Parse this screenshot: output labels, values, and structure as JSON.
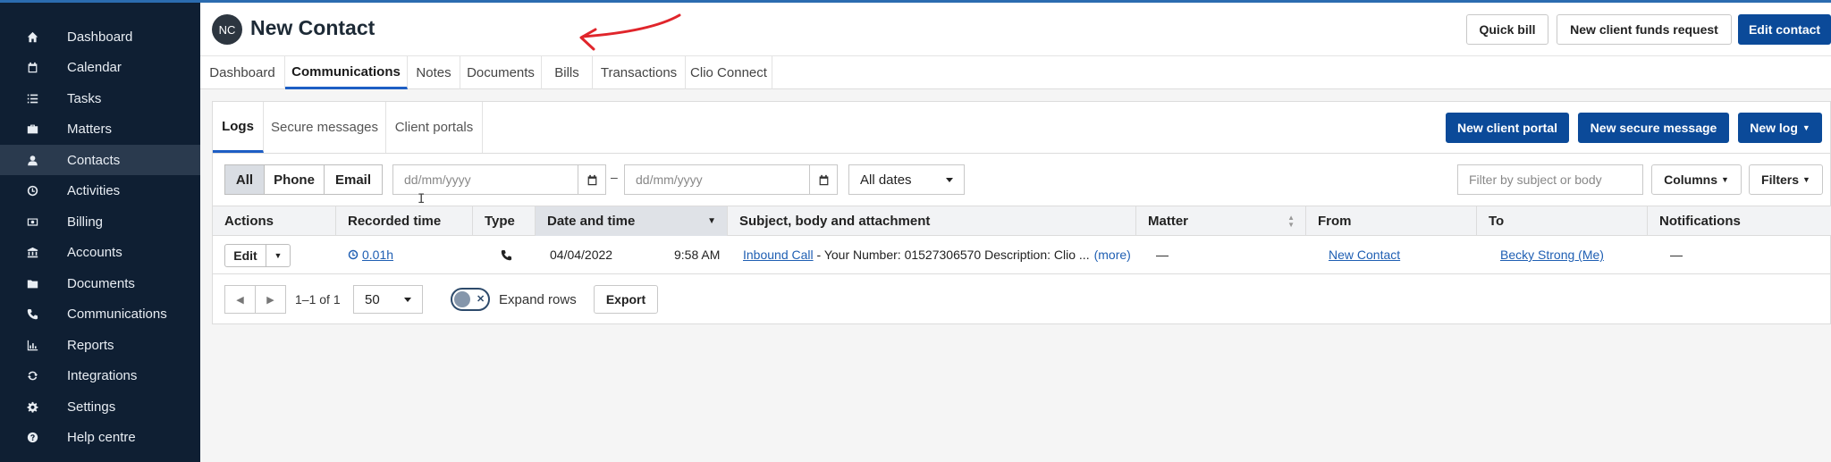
{
  "sidebar": {
    "items": [
      {
        "label": "Dashboard",
        "icon": "home-icon"
      },
      {
        "label": "Calendar",
        "icon": "calendar-icon"
      },
      {
        "label": "Tasks",
        "icon": "list-icon"
      },
      {
        "label": "Matters",
        "icon": "briefcase-icon"
      },
      {
        "label": "Contacts",
        "icon": "user-icon",
        "active": true
      },
      {
        "label": "Activities",
        "icon": "clock-icon"
      },
      {
        "label": "Billing",
        "icon": "money-icon"
      },
      {
        "label": "Accounts",
        "icon": "bank-icon"
      },
      {
        "label": "Documents",
        "icon": "folder-icon"
      },
      {
        "label": "Communications",
        "icon": "phone-icon"
      },
      {
        "label": "Reports",
        "icon": "bar-chart-icon"
      },
      {
        "label": "Integrations",
        "icon": "refresh-icon"
      },
      {
        "label": "Settings",
        "icon": "gear-icon"
      },
      {
        "label": "Help centre",
        "icon": "question-icon"
      }
    ]
  },
  "header": {
    "avatar_initials": "NC",
    "title": "New Contact",
    "buttons": {
      "quick_bill": "Quick bill",
      "funds_request": "New client funds request",
      "edit_contact": "Edit contact"
    }
  },
  "tabs": [
    "Dashboard",
    "Communications",
    "Notes",
    "Documents",
    "Bills",
    "Transactions",
    "Clio Connect"
  ],
  "subtabs": [
    "Logs",
    "Secure messages",
    "Client portals"
  ],
  "actions": {
    "new_client_portal": "New client portal",
    "new_secure_message": "New secure message",
    "new_log": "New log"
  },
  "filters": {
    "types": [
      "All",
      "Phone",
      "Email"
    ],
    "date_from_placeholder": "dd/mm/yyyy",
    "date_separator": "–",
    "date_to_placeholder": "dd/mm/yyyy",
    "date_range": "All dates",
    "search_placeholder": "Filter by subject or body",
    "columns_label": "Columns",
    "filters_label": "Filters"
  },
  "table": {
    "headers": [
      "Actions",
      "Recorded time",
      "Type",
      "Date and time",
      "Subject, body and attachment",
      "Matter",
      "From",
      "To",
      "Notifications"
    ],
    "rows": [
      {
        "edit": "Edit",
        "recorded_time": "0.01h",
        "type_icon": "phone-icon",
        "date": "04/04/2022",
        "time": "9:58 AM",
        "subject_link": "Inbound Call",
        "subject_rest": " - Your Number: 01527306570 Description: Clio ...",
        "more": "(more)",
        "matter": "—",
        "from": "New Contact",
        "to": "Becky Strong (Me)",
        "notifications": "—"
      }
    ]
  },
  "footer": {
    "range": "1–1 of 1",
    "page_size": "50",
    "expand_rows": "Expand rows",
    "export": "Export"
  },
  "colors": {
    "sidebar_bg": "#0f1f33",
    "primary": "#0b4a99",
    "link": "#1f5fb3",
    "annotation_arrow": "#e0252b"
  }
}
